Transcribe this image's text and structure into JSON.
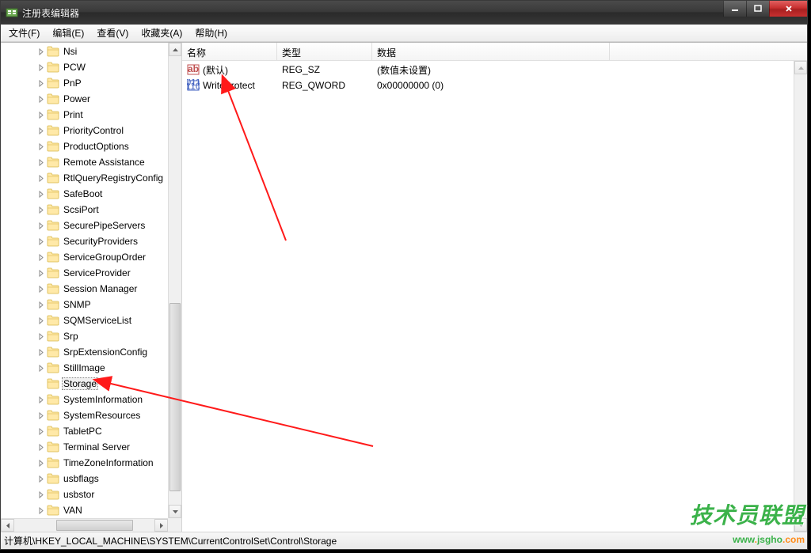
{
  "window": {
    "title": "注册表编辑器"
  },
  "menu": {
    "file": "文件(F)",
    "edit": "编辑(E)",
    "view": "查看(V)",
    "favorites": "收藏夹(A)",
    "help": "帮助(H)"
  },
  "tree": {
    "indent_base": 44,
    "items": [
      {
        "label": "Nsi",
        "sel": false
      },
      {
        "label": "PCW",
        "sel": false
      },
      {
        "label": "PnP",
        "sel": false
      },
      {
        "label": "Power",
        "sel": false
      },
      {
        "label": "Print",
        "sel": false
      },
      {
        "label": "PriorityControl",
        "sel": false
      },
      {
        "label": "ProductOptions",
        "sel": false
      },
      {
        "label": "Remote Assistance",
        "sel": false
      },
      {
        "label": "RtlQueryRegistryConfig",
        "sel": false
      },
      {
        "label": "SafeBoot",
        "sel": false
      },
      {
        "label": "ScsiPort",
        "sel": false
      },
      {
        "label": "SecurePipeServers",
        "sel": false
      },
      {
        "label": "SecurityProviders",
        "sel": false
      },
      {
        "label": "ServiceGroupOrder",
        "sel": false
      },
      {
        "label": "ServiceProvider",
        "sel": false
      },
      {
        "label": "Session Manager",
        "sel": false
      },
      {
        "label": "SNMP",
        "sel": false
      },
      {
        "label": "SQMServiceList",
        "sel": false
      },
      {
        "label": "Srp",
        "sel": false
      },
      {
        "label": "SrpExtensionConfig",
        "sel": false
      },
      {
        "label": "StillImage",
        "sel": false
      },
      {
        "label": "Storage",
        "sel": true
      },
      {
        "label": "SystemInformation",
        "sel": false
      },
      {
        "label": "SystemResources",
        "sel": false
      },
      {
        "label": "TabletPC",
        "sel": false
      },
      {
        "label": "Terminal Server",
        "sel": false
      },
      {
        "label": "TimeZoneInformation",
        "sel": false
      },
      {
        "label": "usbflags",
        "sel": false
      },
      {
        "label": "usbstor",
        "sel": false
      },
      {
        "label": "VAN",
        "sel": false
      }
    ]
  },
  "list": {
    "columns": {
      "name": "名称",
      "type": "类型",
      "data": "数据"
    },
    "col_widths": {
      "name": 120,
      "type": 120,
      "data": 300
    },
    "rows": [
      {
        "icon": "string",
        "name": "(默认)",
        "type": "REG_SZ",
        "data": "(数值未设置)"
      },
      {
        "icon": "binary",
        "name": "WriteProtect",
        "type": "REG_QWORD",
        "data": "0x00000000 (0)"
      }
    ]
  },
  "status": {
    "path": "计算机\\HKEY_LOCAL_MACHINE\\SYSTEM\\CurrentControlSet\\Control\\Storage"
  },
  "watermark": {
    "line1": "技术员联盟",
    "line2_a": "www",
    "line2_dot1": ".",
    "line2_b": "jsgho",
    "line2_dot2": ".",
    "line2_c": "com"
  }
}
